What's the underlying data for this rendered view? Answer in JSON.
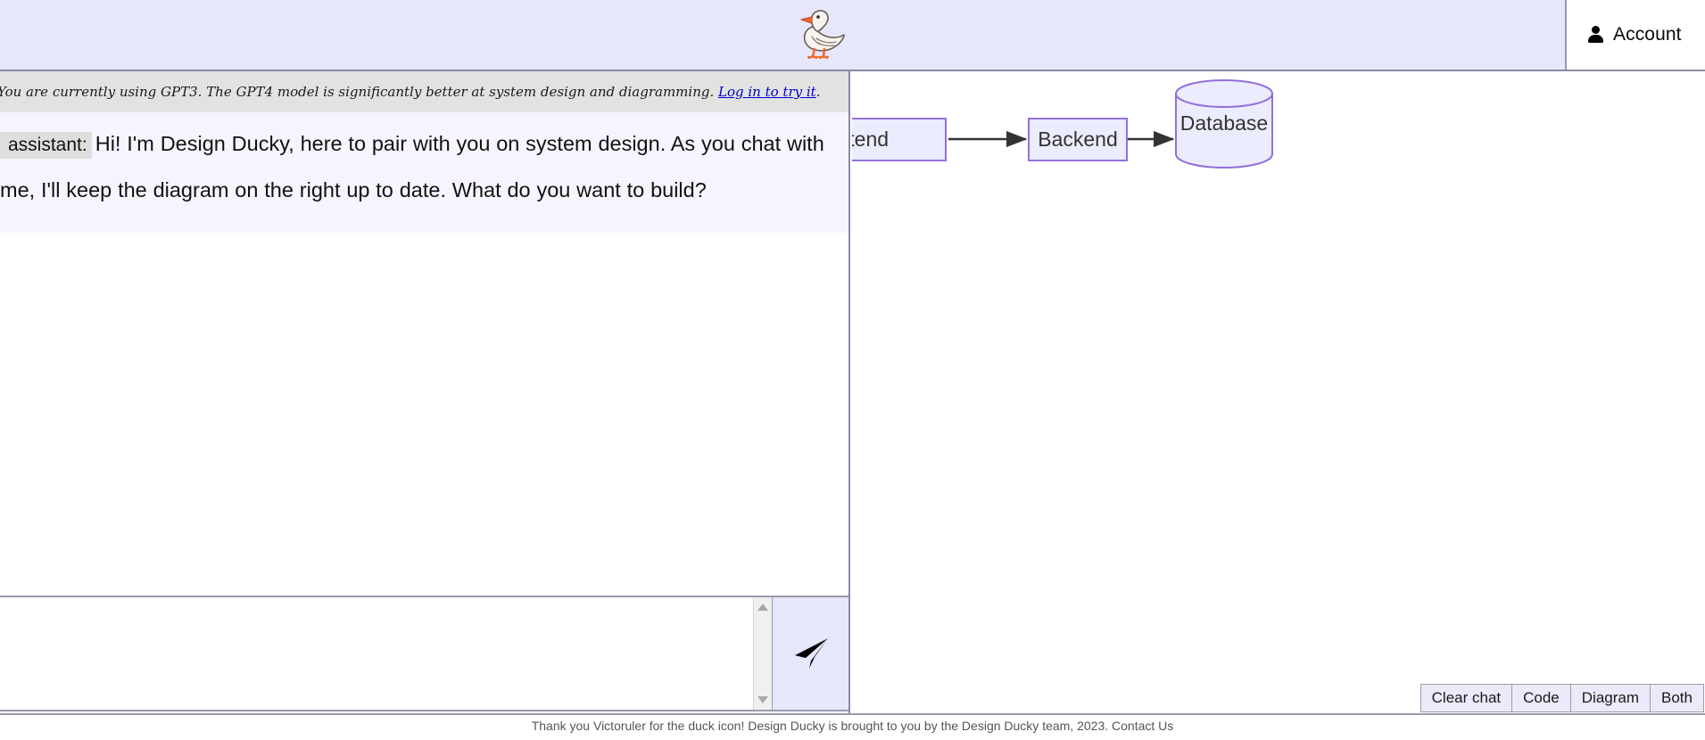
{
  "header": {
    "logo_icon": "duck-icon",
    "account_icon": "person-icon",
    "account_label": "Account"
  },
  "notice": {
    "text_before": "You are currently using GPT3. The GPT4 model is significantly better at system design and diagramming. ",
    "link_text": "Log in to try it",
    "text_after": "."
  },
  "chat": {
    "messages": [
      {
        "role": "assistant:",
        "text": "Hi! I'm Design Ducky, here to pair with you on system design. As you chat with me, I'll keep the diagram on the right up to date. What do you want to build?"
      }
    ],
    "input_value": "",
    "input_placeholder": "",
    "send_icon": "send-paper-plane-icon",
    "scrollbar_up_icon": "scroll-up-arrow-icon",
    "scrollbar_down_icon": "scroll-down-arrow-icon"
  },
  "diagram": {
    "nodes": [
      {
        "id": "frontend",
        "label": "Frontend",
        "shape": "rect"
      },
      {
        "id": "backend",
        "label": "Backend",
        "shape": "rect"
      },
      {
        "id": "database",
        "label": "Database",
        "shape": "cylinder"
      }
    ],
    "edges": [
      {
        "from": "frontend",
        "to": "backend"
      },
      {
        "from": "backend",
        "to": "database"
      }
    ],
    "node_fill": "#ececff",
    "node_stroke": "#9370db",
    "edge_color": "#333333",
    "label_color": "#333333"
  },
  "toolbar": {
    "buttons": [
      {
        "id": "clear-chat",
        "label": "Clear chat"
      },
      {
        "id": "code",
        "label": "Code"
      },
      {
        "id": "diagram",
        "label": "Diagram"
      },
      {
        "id": "both",
        "label": "Both"
      }
    ]
  },
  "footer": {
    "text": "Thank you Victoruler for the duck icon! Design Ducky is brought to you by the Design Ducky team, 2023. Contact Us"
  }
}
